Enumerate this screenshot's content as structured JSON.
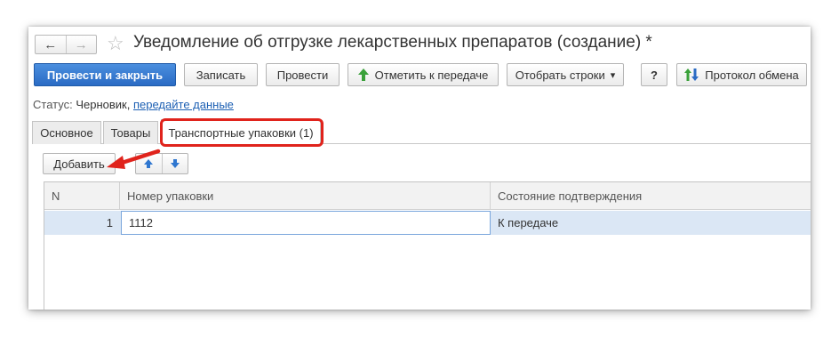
{
  "window": {
    "title": "Уведомление об отгрузке лекарственных препаратов (создание) *",
    "nav_back": "←",
    "nav_forward": "→",
    "star": "☆"
  },
  "toolbar": {
    "post_close": "Провести и закрыть",
    "save": "Записать",
    "post": "Провести",
    "mark_transfer": "Отметить к передаче",
    "select_rows": "Отобрать строки",
    "select_rows_caret": "▾",
    "help": "?",
    "exchange_log": "Протокол обмена"
  },
  "status": {
    "label": "Статус:",
    "value": "Черновик,",
    "link": "передайте данные"
  },
  "tabs": [
    {
      "label": "Основное"
    },
    {
      "label": "Товары"
    },
    {
      "label": "Транспортные упаковки (1)"
    }
  ],
  "content_toolbar": {
    "add": "Добавить"
  },
  "table": {
    "columns": [
      "N",
      "Номер упаковки",
      "Состояние подтверждения"
    ],
    "rows": [
      {
        "n": "1",
        "package_number": "1112",
        "state": "К передаче"
      }
    ]
  },
  "colors": {
    "accent": "#2a6bc4",
    "highlight": "#e0231c",
    "selected_row": "#dbe7f5",
    "link": "#1c5fb3"
  }
}
